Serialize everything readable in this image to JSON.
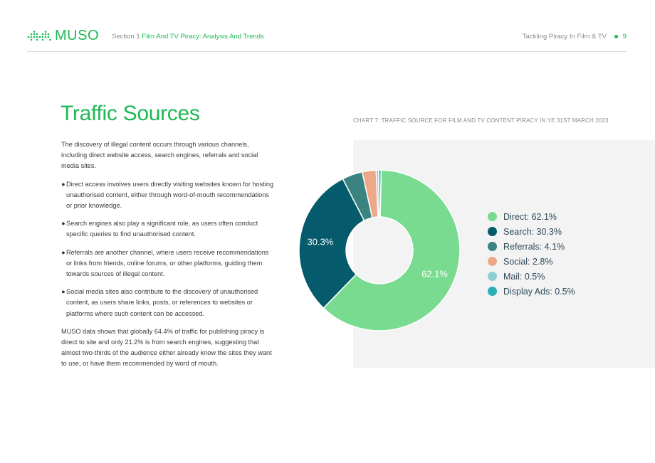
{
  "header": {
    "logo_text": "MUSO",
    "section_prefix": "Section 1",
    "section_title": "Film And TV Piracy: Analysis And Trends",
    "doc_title": "Tackling Piracy In Film & TV",
    "page_number": "9",
    "accent_color": "#1db954"
  },
  "main": {
    "heading": "Traffic Sources",
    "intro": "The discovery of illegal content occurs through various channels, including direct website access, search engines, referrals and social media sites.",
    "bullets": [
      "Direct access involves users directly visiting websites known for hosting unauthorised content, either through word-of-mouth recommendations or prior knowledge.",
      "Search engines also play a significant role, as users often conduct specific queries to find unauthorised content.",
      "Referrals are another channel, where users receive recommendations or links from friends, online forums, or other platforms, guiding them towards sources of illegal content.",
      "Social media sites also contribute to the discovery of unauthorised content, as users share links, posts, or references to websites or platforms where such content can be accessed."
    ],
    "bullet_symbol": "●",
    "conclusion": "MUSO data shows that globally 64.4% of traffic for publishing piracy is direct to site and only 21.2% is from search engines, suggesting that almost two-thirds of the audience either already know the sites they want to use, or have them recommended by word of mouth."
  },
  "chart_caption": "CHART 7: TRAFFIC SOURCE FOR FILM AND TV CONTENT PIRACY IN YE 31ST MARCH 2023",
  "chart_data": {
    "type": "pie",
    "donut": true,
    "title": "CHART 7: TRAFFIC SOURCE FOR FILM AND TV CONTENT PIRACY IN YE 31ST MARCH 2023",
    "legend_position": "right",
    "slices": [
      {
        "label": "Direct",
        "value": 62.1,
        "color": "#79db8f",
        "legend": "Direct: 62.1%",
        "data_label": "62.1%"
      },
      {
        "label": "Search",
        "value": 30.3,
        "color": "#055a6b",
        "legend": "Search: 30.3%",
        "data_label": "30.3%"
      },
      {
        "label": "Referrals",
        "value": 4.1,
        "color": "#3a8380",
        "legend": "Referrals: 4.1%",
        "data_label": ""
      },
      {
        "label": "Social",
        "value": 2.8,
        "color": "#eda88a",
        "legend": "Social: 2.8%",
        "data_label": ""
      },
      {
        "label": "Mail",
        "value": 0.5,
        "color": "#8ccfd1",
        "legend": "Mail: 0.5%",
        "data_label": ""
      },
      {
        "label": "Display Ads",
        "value": 0.5,
        "color": "#2ab0b3",
        "legend": "Display Ads: 0.5%",
        "data_label": ""
      }
    ]
  }
}
